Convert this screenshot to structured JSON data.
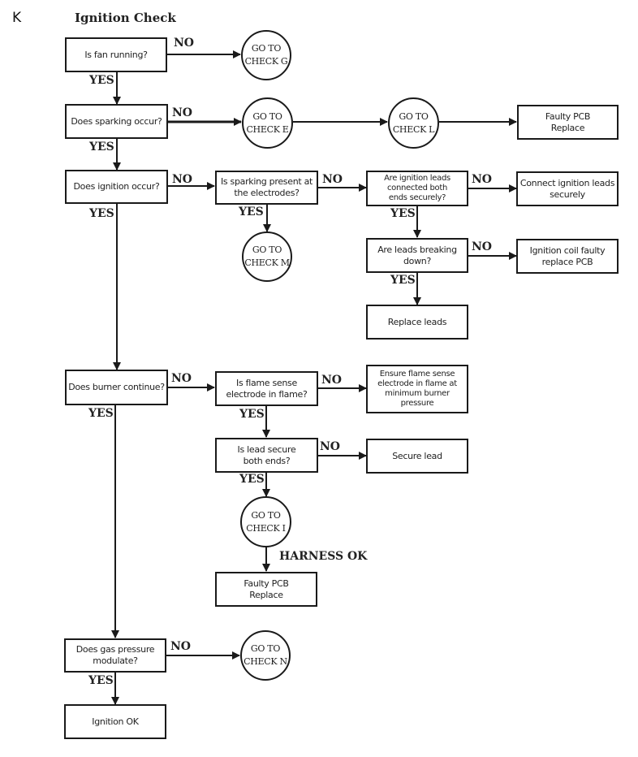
{
  "section_letter": "K",
  "title": "Ignition Check",
  "nodes": {
    "fan": "Is fan running?",
    "goto_g": "GO TO\nCHECK G",
    "spark": "Does sparking occur?",
    "goto_e": "GO TO\nCHECK E",
    "goto_l": "GO TO\nCHECK L",
    "faulty_pcb_1": "Faulty PCB\nReplace",
    "ignition": "Does ignition occur?",
    "spark_electrodes": "Is sparking present at\nthe electrodes?",
    "leads_connected": "Are ignition leads\nconnected both\nends securely?",
    "connect_leads": "Connect ignition leads\nsecurely",
    "goto_m": "GO TO\nCHECK M",
    "leads_breaking": "Are leads breaking\ndown?",
    "coil_faulty": "Ignition coil faulty\nreplace PCB",
    "replace_leads": "Replace leads",
    "burner": "Does burner continue?",
    "flame_sense": "Is flame sense\nelectrode in flame?",
    "ensure_flame": "Ensure flame sense\nelectrode in flame at\nminimum burner\npressure",
    "lead_secure": "Is lead secure\nboth ends?",
    "secure_lead": "Secure lead",
    "goto_i": "GO TO\nCHECK I",
    "faulty_pcb_2": "Faulty PCB\nReplace",
    "gas_pressure": "Does gas pressure\nmodulate?",
    "goto_n": "GO TO\nCHECK N",
    "ignition_ok": "Ignition OK"
  },
  "labels": {
    "yes": "YES",
    "no": "NO",
    "harness_ok": "HARNESS OK"
  },
  "colors": {
    "line": "#1a1a1a",
    "background": "#ffffff"
  }
}
